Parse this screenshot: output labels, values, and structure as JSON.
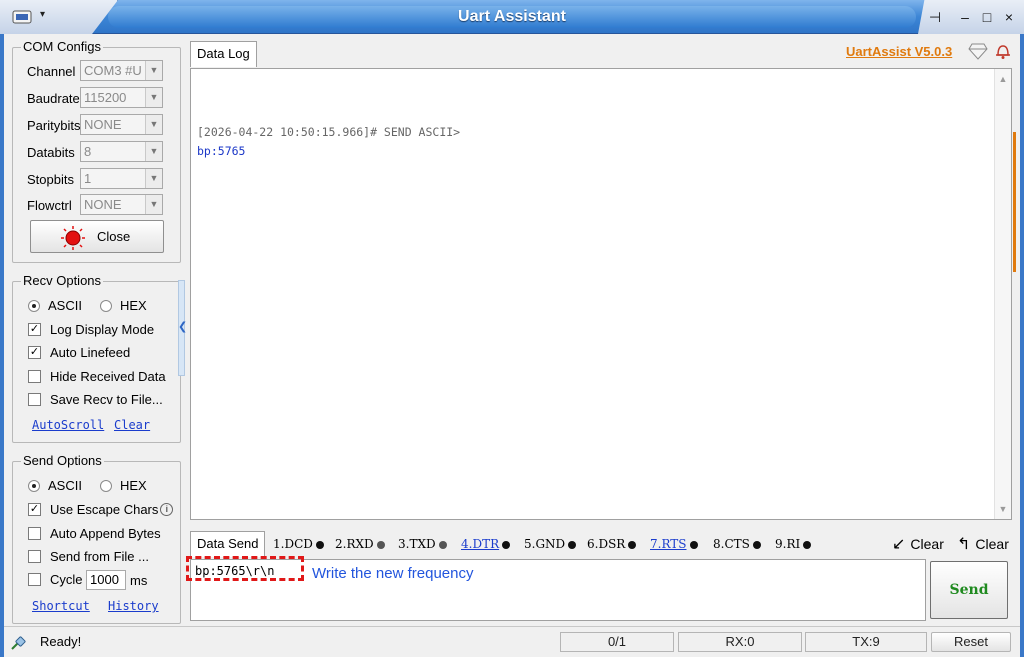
{
  "window": {
    "title": "Uart Assistant",
    "menu_caret": "▾",
    "pin": "⊣",
    "minimize": "–",
    "maximize": "□",
    "close": "×"
  },
  "version_link": "UartAssist V5.0.3",
  "com": {
    "title": "COM Configs",
    "channel": {
      "label": "Channel",
      "value": "COM3 #U"
    },
    "baudrate": {
      "label": "Baudrate",
      "value": "115200"
    },
    "paritybits": {
      "label": "Paritybits",
      "value": "NONE"
    },
    "databits": {
      "label": "Databits",
      "value": "8"
    },
    "stopbits": {
      "label": "Stopbits",
      "value": "1"
    },
    "flowctrl": {
      "label": "Flowctrl",
      "value": "NONE"
    },
    "close_label": "Close"
  },
  "recv": {
    "title": "Recv Options",
    "ascii": "ASCII",
    "hex": "HEX",
    "log_display": "Log Display Mode",
    "auto_linefeed": "Auto Linefeed",
    "hide_received": "Hide Received Data",
    "save_recv": "Save Recv to File...",
    "autoscroll": "AutoScroll",
    "clear": "Clear"
  },
  "send_opts": {
    "title": "Send Options",
    "ascii": "ASCII",
    "hex": "HEX",
    "escape": "Use Escape Chars",
    "append": "Auto Append Bytes",
    "from_file": "Send from File ...",
    "cycle": "Cycle",
    "cycle_value": "1000",
    "ms": "ms",
    "shortcut": "Shortcut",
    "history": "History"
  },
  "log": {
    "tab": "Data Log",
    "line1": "[2026-04-22 10:50:15.966]# SEND ASCII>",
    "line2": "bp:5765"
  },
  "send": {
    "tab": "Data Send",
    "signals": [
      "1.DCD",
      "2.RXD",
      "3.TXD",
      "4.DTR",
      "5.GND",
      "6.DSR",
      "7.RTS",
      "8.CTS",
      "9.RI"
    ],
    "clear1": "Clear",
    "clear2": "Clear",
    "input": "bp:5765\\r\\n",
    "annotation": "Write the new frequency",
    "send_label": "Send"
  },
  "status": {
    "ready": "Ready!",
    "count": "0/1",
    "rx": "RX:0",
    "tx": "TX:9",
    "reset": "Reset"
  },
  "colors": {
    "title_bar": "#3d86d6",
    "version": "#e07a0e",
    "link": "#1a3ccc",
    "send_green": "#1f8a1f",
    "annotation": "#2255dd",
    "highlight": "#e01818"
  }
}
